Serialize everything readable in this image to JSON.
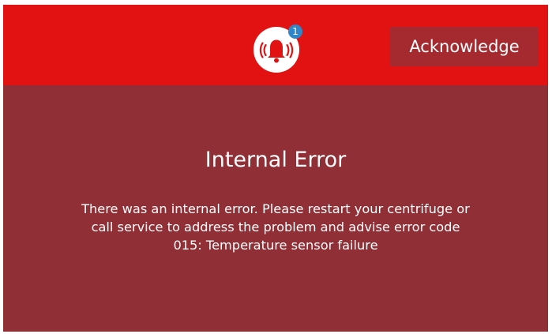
{
  "header": {
    "notification_count": "1",
    "acknowledge_label": "Acknowledge"
  },
  "error": {
    "title": "Internal Error",
    "message_lines": [
      "There was an internal error. Please restart your centrifuge or",
      "call service to address the problem and advise error code",
      "015: Temperature sensor failure"
    ]
  },
  "colors": {
    "header_background": "#e31212",
    "panel_background": "#902f35",
    "button_background": "#a52a30",
    "badge_background": "#2f86c9",
    "text": "#ffffff"
  },
  "icons": {
    "alarm": "alarm-bell-icon"
  }
}
